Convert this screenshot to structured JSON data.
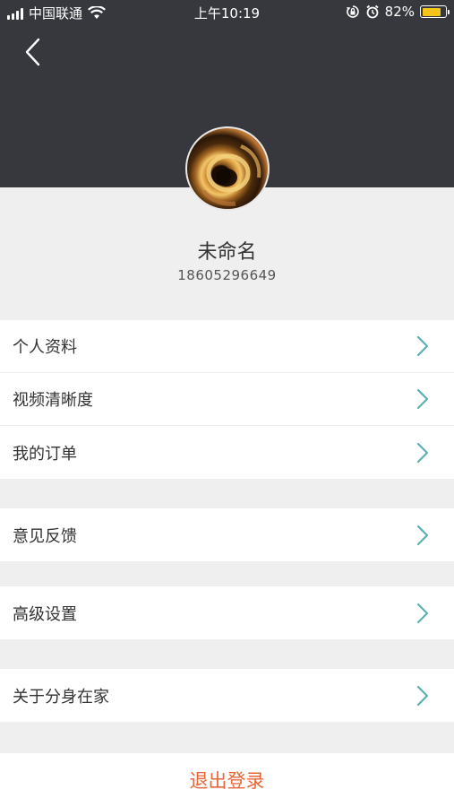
{
  "status_bar": {
    "carrier": "中国联通",
    "time": "上午10:19",
    "battery_percent": "82%",
    "battery_level": 0.82,
    "icons": [
      "signal-icon",
      "wifi-icon",
      "rotation-lock-icon",
      "alarm-icon",
      "battery-icon"
    ]
  },
  "header": {
    "back_icon": "chevron-left-icon",
    "background_color": "#36383d"
  },
  "profile": {
    "name": "未命名",
    "phone": "18605296649"
  },
  "menu": {
    "group1": [
      {
        "label": "个人资料"
      },
      {
        "label": "视频清晰度"
      },
      {
        "label": "我的订单"
      }
    ],
    "group2": [
      {
        "label": "意见反馈"
      }
    ],
    "group3": [
      {
        "label": "高级设置"
      }
    ],
    "group4": [
      {
        "label": "关于分身在家"
      }
    ],
    "chevron_color": "#5db0b2"
  },
  "logout": {
    "label": "退出登录",
    "color": "#e8663a"
  }
}
